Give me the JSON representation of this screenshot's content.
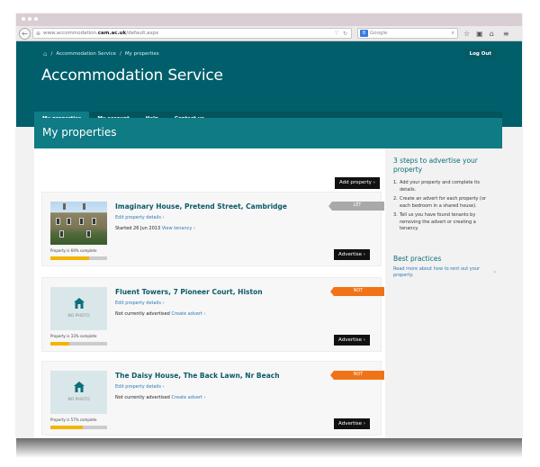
{
  "browser": {
    "url_prefix": "www.accommodation.",
    "url_domain": "cam.ac.uk",
    "url_suffix": "/default.aspx",
    "search_placeholder": "Google"
  },
  "header": {
    "breadcrumb": [
      "Accommodation Service",
      "My properties"
    ],
    "breadcrumb_separator": "/",
    "title": "Accommodation Service",
    "logout_label": "Log Out"
  },
  "tabs": [
    {
      "label": "My properties",
      "active": true
    },
    {
      "label": "My account",
      "active": false
    },
    {
      "label": "Help",
      "active": false
    },
    {
      "label": "Contact us",
      "active": false
    }
  ],
  "page": {
    "title": "My properties",
    "add_property_label": "Add property",
    "chevron": "›"
  },
  "properties": [
    {
      "title": "Imaginary House, Pretend Street, Cambridge",
      "edit_label": "Edit property details",
      "status_text": "Started 26 Jun 2013",
      "status_link": "View tenancy",
      "ribbon": "LET",
      "ribbon_color": "#a9a9a9",
      "photo": true,
      "complete_text": "Property is 69% complete",
      "complete_percent": 69,
      "advertise_label": "Advertise"
    },
    {
      "title": "Fluent Towers, 7 Pioneer Court, Histon",
      "edit_label": "Edit property details",
      "status_text": "Not currently advertised",
      "status_link": "Create advert",
      "ribbon": "NOT ADVERTISED",
      "ribbon_color": "#f07417",
      "photo": false,
      "no_photo_label": "NO PHOTO",
      "complete_text": "Property is 33% complete",
      "complete_percent": 33,
      "advertise_label": "Advertise"
    },
    {
      "title": "The Daisy House, The Back Lawn, Nr Beach",
      "edit_label": "Edit property details",
      "status_text": "Not currently advertised",
      "status_link": "Create advert",
      "ribbon": "NOT ADVERTISED",
      "ribbon_color": "#f07417",
      "photo": false,
      "no_photo_label": "NO PHOTO",
      "complete_text": "Property is 57% complete",
      "complete_percent": 57,
      "advertise_label": "Advertise"
    }
  ],
  "sidebar": {
    "title": "3 steps to advertise your property",
    "steps": [
      {
        "n": "1.",
        "text": "Add your property and complete its details."
      },
      {
        "n": "2.",
        "text": "Create an advert for each property (or each bedroom in a shared house)."
      },
      {
        "n": "3.",
        "text": "Tell us you have found tenants by removing the advert or creating a tenancy."
      }
    ],
    "best_practices_title": "Best practices",
    "best_practices_link": "Read more about how to rent out your property."
  },
  "colors": {
    "header": "#005f6b",
    "active_tab": "#0f7b85",
    "progress": "#f4b400",
    "not_advertised": "#f07417",
    "let": "#a9a9a9"
  }
}
